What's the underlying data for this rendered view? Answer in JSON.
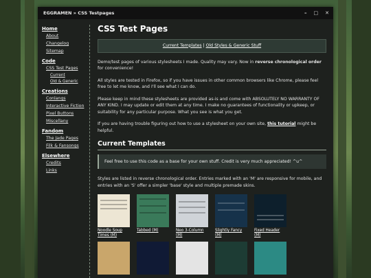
{
  "window": {
    "title": "EGGRAMEN » CSS Testpages"
  },
  "sidebar": [
    {
      "title": "Home",
      "links": [
        {
          "label": "About"
        },
        {
          "label": "Changelog"
        },
        {
          "label": "Sitemap"
        }
      ]
    },
    {
      "title": "Code",
      "links": [
        {
          "label": "CSS Test Pages"
        }
      ],
      "sublinks": [
        {
          "label": "Current"
        },
        {
          "label": "Old & Generic"
        }
      ]
    },
    {
      "title": "Creations",
      "links": [
        {
          "label": "Conlangs"
        },
        {
          "label": "Interactive Fiction"
        },
        {
          "label": "Pixel Buttons"
        },
        {
          "label": "Miscellany"
        }
      ]
    },
    {
      "title": "Fandom",
      "links": [
        {
          "label": "The Jade Pages"
        },
        {
          "label": "Filk & Fansongs"
        }
      ]
    },
    {
      "title": "Elsewhere",
      "links": [
        {
          "label": "Credits"
        },
        {
          "label": "Links"
        }
      ]
    }
  ],
  "main": {
    "heading": "CSS Test Pages",
    "nav": {
      "link1": "Current Templates",
      "sep": " | ",
      "link2": "Old Styles & Generic Stuff"
    },
    "p1_a": "Demo/test pages of various stylesheets I made. Quality may vary. Now in ",
    "p1_b": "reverse chronological order",
    "p1_c": " for convenience!",
    "p2": "All styles are tested in Firefox, so if you have issues in other common browsers like Chrome, please feel free to let me know, and I'll see what I can do.",
    "p3": "Please keep in mind these stylesheets are provided as-is and come with ABSOLUTELY NO WARRANTY OF ANY KIND. I may update or edit them at any time. I make no guarantees of functionality or upkeep, or suitability for any particular purpose. What you see is what you get.",
    "p4_a": "If you are having trouble figuring out how to use a stylesheet on your own site, ",
    "p4_b": "this tutorial",
    "p4_c": " might be helpful.",
    "h2": "Current Templates",
    "callout": "Feel free to use this code as a base for your own stuff. Credit is very much appreciated! ^u^",
    "p5": "Styles are listed in reverse chronological order. Entries marked with an 'M' are responsive for mobile, and entries with an 'S' offer a simpler 'base' style and multiple premade skins.",
    "templates": [
      {
        "label": "Noodle Soup Times (M)",
        "color": "#ede6d4"
      },
      {
        "label": "Tabbed (M)",
        "color": "#3a7a5a"
      },
      {
        "label": "Neo 3-Column (M)",
        "color": "#cfd3d8"
      },
      {
        "label": "Slightly Fancy (M)",
        "color": "#16324a"
      },
      {
        "label": "Fixed Header (M)",
        "color": "#0d1f2c"
      },
      {
        "label": "",
        "color": "#c9a66b"
      },
      {
        "label": "",
        "color": "#101a35"
      },
      {
        "label": "",
        "color": "#e4e4e4"
      },
      {
        "label": "",
        "color": "#1d3c34"
      },
      {
        "label": "",
        "color": "#2c8a84"
      }
    ]
  }
}
